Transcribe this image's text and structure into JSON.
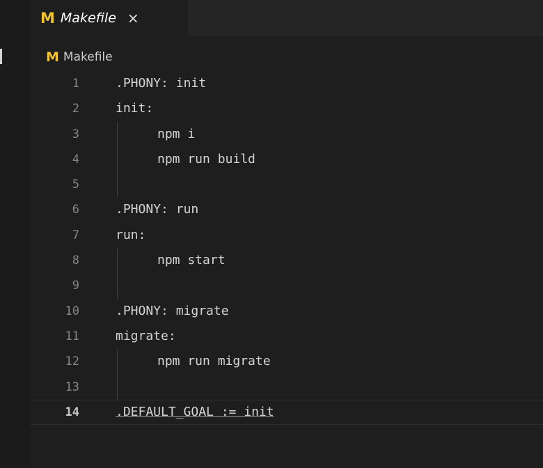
{
  "tab": {
    "icon": "M",
    "label": "Makefile",
    "close": "×"
  },
  "breadcrumb": {
    "icon": "M",
    "label": "Makefile"
  },
  "lines": [
    {
      "num": "1",
      "text": ".PHONY: init",
      "indent": false
    },
    {
      "num": "2",
      "text": "init:",
      "indent": false
    },
    {
      "num": "3",
      "text": "npm i",
      "indent": true
    },
    {
      "num": "4",
      "text": "npm run build",
      "indent": true
    },
    {
      "num": "5",
      "text": "",
      "indent": true
    },
    {
      "num": "6",
      "text": ".PHONY: run",
      "indent": false
    },
    {
      "num": "7",
      "text": "run:",
      "indent": false
    },
    {
      "num": "8",
      "text": "npm start",
      "indent": true
    },
    {
      "num": "9",
      "text": "",
      "indent": true
    },
    {
      "num": "10",
      "text": ".PHONY: migrate",
      "indent": false
    },
    {
      "num": "11",
      "text": "migrate:",
      "indent": false
    },
    {
      "num": "12",
      "text": "npm run migrate",
      "indent": true
    },
    {
      "num": "13",
      "text": "",
      "indent": true
    },
    {
      "num": "14",
      "text": ".DEFAULT_GOAL := init",
      "indent": false
    }
  ],
  "active_line": "14",
  "colors": {
    "background": "#1e1e1e",
    "makefile_icon": "#f1c232",
    "line_number": "#858585",
    "code_text": "#d4d4d4"
  }
}
